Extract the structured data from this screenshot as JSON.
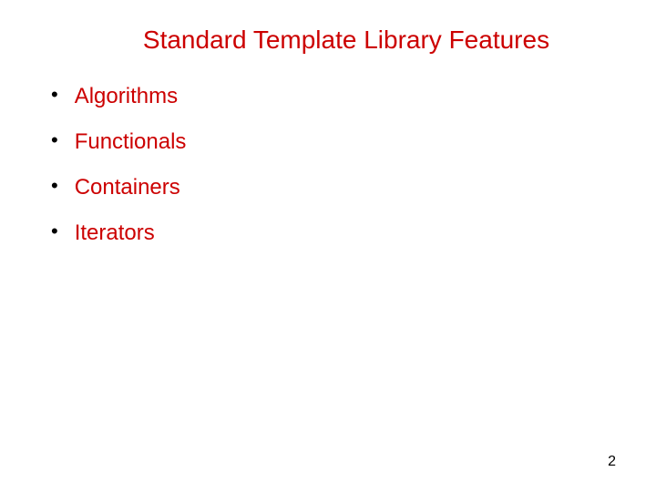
{
  "slide": {
    "title": "Standard Template Library Features",
    "bullets": [
      {
        "text": "Algorithms"
      },
      {
        "text": "Functionals"
      },
      {
        "text": "Containers"
      },
      {
        "text": "Iterators"
      }
    ],
    "page_number": "2"
  }
}
